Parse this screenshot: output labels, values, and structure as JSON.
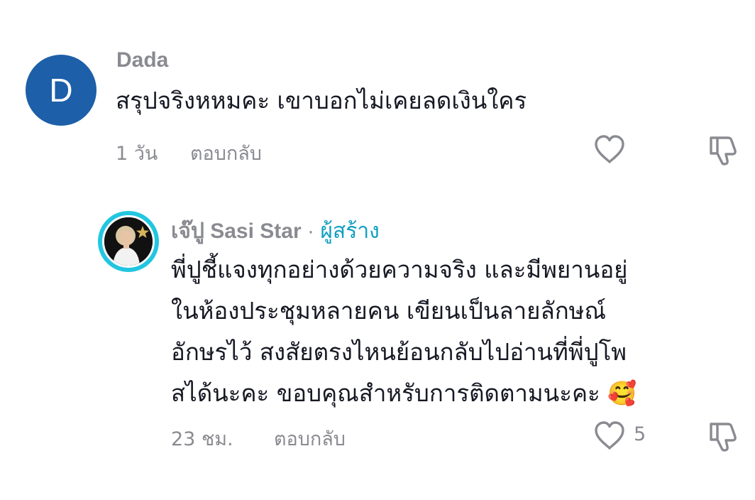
{
  "comment": {
    "avatar_letter": "D",
    "avatar_color": "#1d5fa8",
    "username": "Dada",
    "text": "สรุปจริงหหมคะ เขาบอกไม่เคยลดเงินใคร",
    "time": "1 วัน",
    "reply_label": "ตอบกลับ",
    "like_icon": "heart-outline",
    "dislike_icon": "thumbs-down-outline"
  },
  "reply": {
    "username": "เจ๊ปู Sasi Star",
    "separator": "·",
    "creator_label": "ผู้สร้าง",
    "avatar_ring_color": "#22c6e0",
    "text_lines": [
      "พี่ปูชี้แจงทุกอย่างด้วยความจริง และมีพยานอยู่",
      "ในห้องประชุมหลายคน เขียนเป็นลายลักษณ์",
      "อักษรไว้ สงสัยตรงไหนย้อนกลับไปอ่านที่พี่ปูโพ",
      "สได้นะคะ ขอบคุณสำหรับการติดตามนะคะ"
    ],
    "emoji": "🥰",
    "time": "23 ชม.",
    "reply_label": "ตอบกลับ",
    "like_count": "5",
    "like_icon": "heart-outline",
    "dislike_icon": "thumbs-down-outline"
  }
}
